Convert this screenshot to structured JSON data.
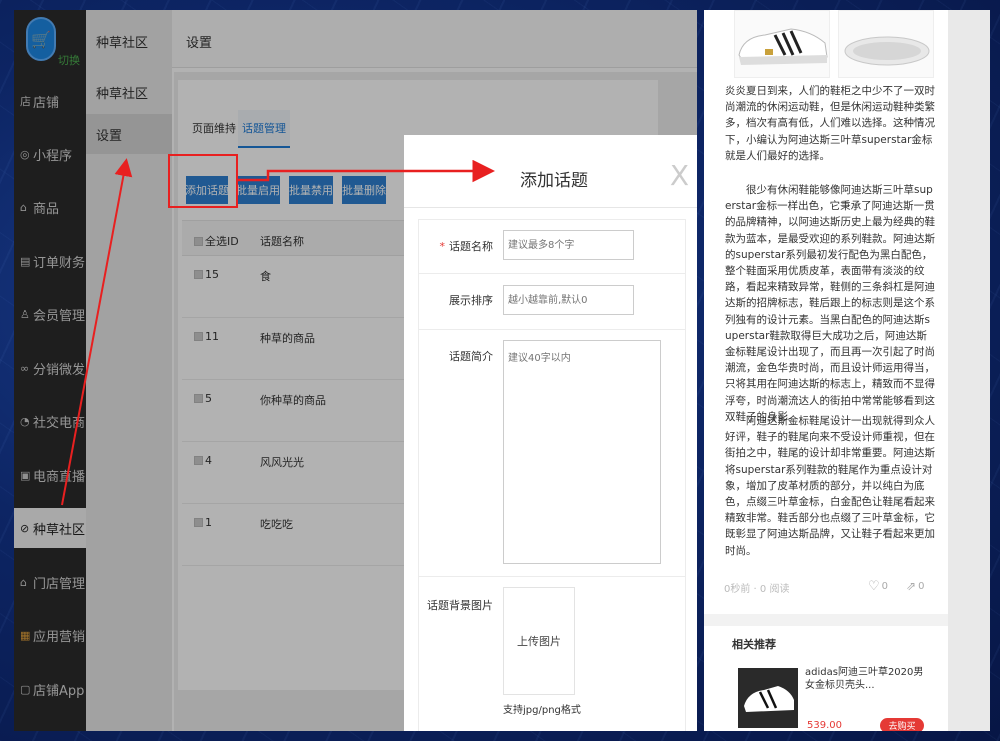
{
  "sidebar": {
    "switch_label": "切换",
    "items": [
      {
        "label": "店铺",
        "icon": "店"
      },
      {
        "label": "小程序",
        "icon": "◎"
      },
      {
        "label": "商品",
        "icon": "⌂"
      },
      {
        "label": "订单财务",
        "icon": "▤"
      },
      {
        "label": "会员管理",
        "icon": "♙"
      },
      {
        "label": "分销微发",
        "icon": "∞"
      },
      {
        "label": "社交电商",
        "icon": "◔"
      },
      {
        "label": "电商直播",
        "icon": "▣"
      },
      {
        "label": "种草社区",
        "icon": "⊘"
      },
      {
        "label": "门店管理",
        "icon": "⌂"
      },
      {
        "label": "应用营销",
        "icon": "▦"
      },
      {
        "label": "店铺App",
        "icon": "▢"
      }
    ]
  },
  "subnav": {
    "title": "种草社区",
    "items": [
      "种草社区",
      "设置"
    ]
  },
  "topbar": {
    "title": "设置"
  },
  "tabs": [
    "页面维持",
    "话题管理"
  ],
  "actions": {
    "add": "添加话题",
    "enable": "批量启用",
    "disable": "批量禁用",
    "delete": "批量删除"
  },
  "table": {
    "headers": [
      "全选ID",
      "话题名称"
    ],
    "rows": [
      {
        "id": "15",
        "name": "食"
      },
      {
        "id": "11",
        "name": "种草的商品"
      },
      {
        "id": "5",
        "name": "你种草的商品"
      },
      {
        "id": "4",
        "name": "风风光光"
      },
      {
        "id": "1",
        "name": "吃吃吃"
      }
    ]
  },
  "modal": {
    "title": "添加话题",
    "close": "X",
    "fields": {
      "name_label": "话题名称",
      "name_placeholder": "建议最多8个字",
      "order_label": "展示排序",
      "order_placeholder": "越小越靠前,默认0",
      "intro_label": "话题简介",
      "intro_placeholder": "建议40字以内",
      "bg_label": "话题背景图片",
      "upload": "上传图片",
      "upload_hint": "支持jpg/png格式"
    }
  },
  "article": {
    "paragraphs": [
      "炎炎夏日到来，人们的鞋柜之中少不了一双时尚潮流的休闲运动鞋，但是休闲运动鞋种类繁多，档次有高有低，人们难以选择。这种情况下，小编认为阿迪达斯三叶草superstar金标就是人们最好的选择。",
      "　　很少有休闲鞋能够像阿迪达斯三叶草superstar金标一样出色，它秉承了阿迪达斯一贯的品牌精神，以阿迪达斯历史上最为经典的鞋款为蓝本，是最受欢迎的系列鞋款。阿迪达斯的superstar系列最初发行配色为黑白配色，整个鞋面采用优质皮革，表面带有淡淡的纹路，看起来精致异常，鞋侧的三条斜杠是阿迪达斯的招牌标志，鞋后跟上的标志则是这个系列独有的设计元素。当黑白配色的阿迪达斯superstar鞋款取得巨大成功之后，阿迪达斯金标鞋尾设计出现了，而且再一次引起了时尚潮流，金色华贵时尚，而且设计师运用得当，只将其用在阿迪达斯的标志上，精致而不显得浮夸，时尚潮流达人的街拍中常常能够看到这双鞋子的身影。",
      "　　阿迪达斯金标鞋尾设计一出现就得到众人好评，鞋子的鞋尾向来不受设计师重视，但在街拍之中，鞋尾的设计却非常重要。阿迪达斯将superstar系列鞋款的鞋尾作为重点设计对象，增加了皮革材质的部分，并以纯白为底色，点缀三叶草金标，白金配色让鞋尾看起来精致非常。鞋舌部分也点缀了三叶草金标，它既彰显了阿迪达斯品牌，又让鞋子看起来更加时尚。"
    ],
    "meta": "0秒前 · 0 阅读",
    "likes": "0",
    "shares": "0"
  },
  "related": {
    "title": "相关推荐",
    "product_name": "adidas阿迪三叶草2020男女金标贝壳头...",
    "price": "539.00",
    "buy": "去购买"
  },
  "colors": {
    "accent_blue": "#2f80d1",
    "annotation_red": "#e82020",
    "price_red": "#e53935",
    "sidebar_dark": "#2b2b2b"
  }
}
